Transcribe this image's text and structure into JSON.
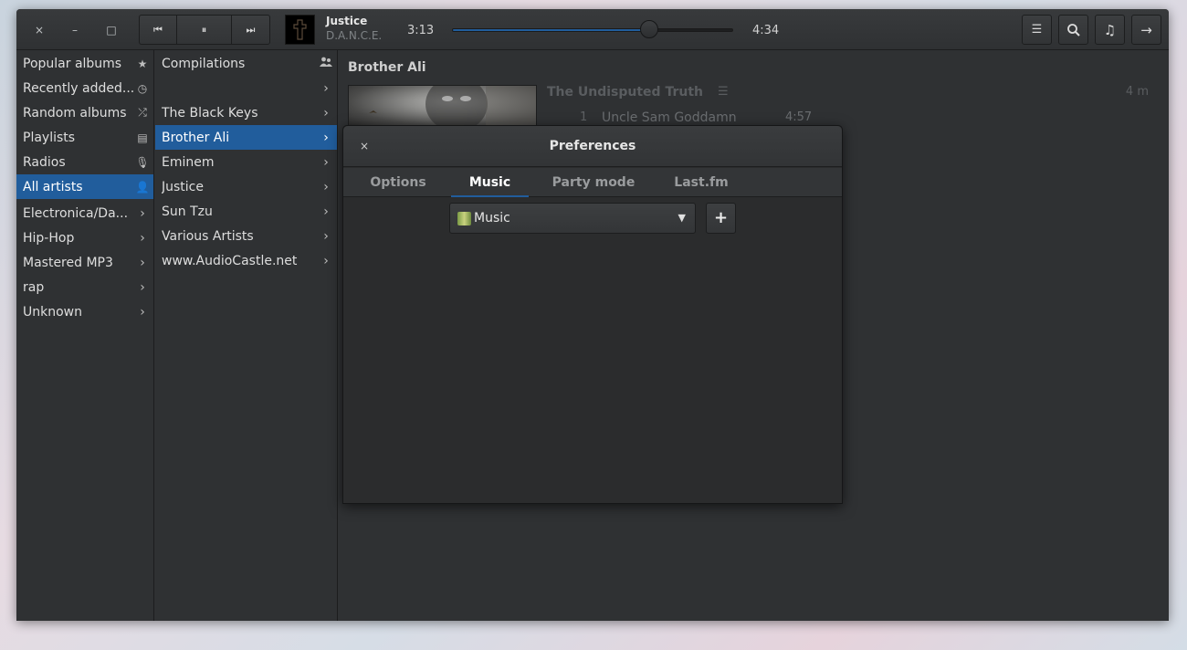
{
  "window_controls": {
    "close": "×",
    "minimize": "–",
    "maximize": "□"
  },
  "player": {
    "prev_glyph": "⏮",
    "pause_glyph": "⏸",
    "next_glyph": "⏭",
    "track_title": "Justice",
    "track_album": "D.A.N.C.E.",
    "elapsed": "3:13",
    "total": "4:34",
    "progress_fraction": 0.7
  },
  "toolbar": {
    "list_glyph": "☰",
    "search_glyph": "⌕",
    "music_glyph": "♫",
    "arrow_glyph": "→"
  },
  "sidebar": {
    "items": [
      {
        "label": "Popular albums",
        "icon": "star-icon",
        "glyph": "★"
      },
      {
        "label": "Recently added...",
        "icon": "clock-icon",
        "glyph": "◷"
      },
      {
        "label": "Random albums",
        "icon": "shuffle-icon",
        "glyph": "⤮"
      },
      {
        "label": "Playlists",
        "icon": "playlist-icon",
        "glyph": "▤"
      },
      {
        "label": "Radios",
        "icon": "microphone-icon",
        "glyph": "🎙"
      },
      {
        "label": "All artists",
        "icon": "person-icon",
        "glyph": "👤"
      }
    ],
    "genres": [
      {
        "label": "Electronica/Da..."
      },
      {
        "label": "Hip-Hop"
      },
      {
        "label": "Mastered MP3"
      },
      {
        "label": "rap"
      },
      {
        "label": "Unknown"
      }
    ],
    "chevron": "›"
  },
  "artists": {
    "compilations_label": "Compilations",
    "items": [
      {
        "label": ""
      },
      {
        "label": "The Black Keys"
      },
      {
        "label": "Brother Ali"
      },
      {
        "label": "Eminem"
      },
      {
        "label": "Justice"
      },
      {
        "label": "Sun Tzu"
      },
      {
        "label": "Various Artists"
      },
      {
        "label": "www.AudioCastle.net"
      }
    ]
  },
  "content": {
    "artist_name": "Brother Ali",
    "album_title": "The Undisputed Truth",
    "album_menu_glyph": "☰",
    "album_duration": "4 m",
    "track": {
      "number": "1",
      "title": "Uncle Sam Goddamn",
      "length": "4:57"
    }
  },
  "dialog": {
    "close": "×",
    "title": "Preferences",
    "tabs": [
      "Options",
      "Music",
      "Party mode",
      "Last.fm"
    ],
    "active_tab": "Music",
    "combo_value": "Music",
    "combo_arrow": "▼",
    "add_label": "+"
  },
  "colors": {
    "accent": "#215d9c",
    "window_bg": "#2f3133"
  }
}
